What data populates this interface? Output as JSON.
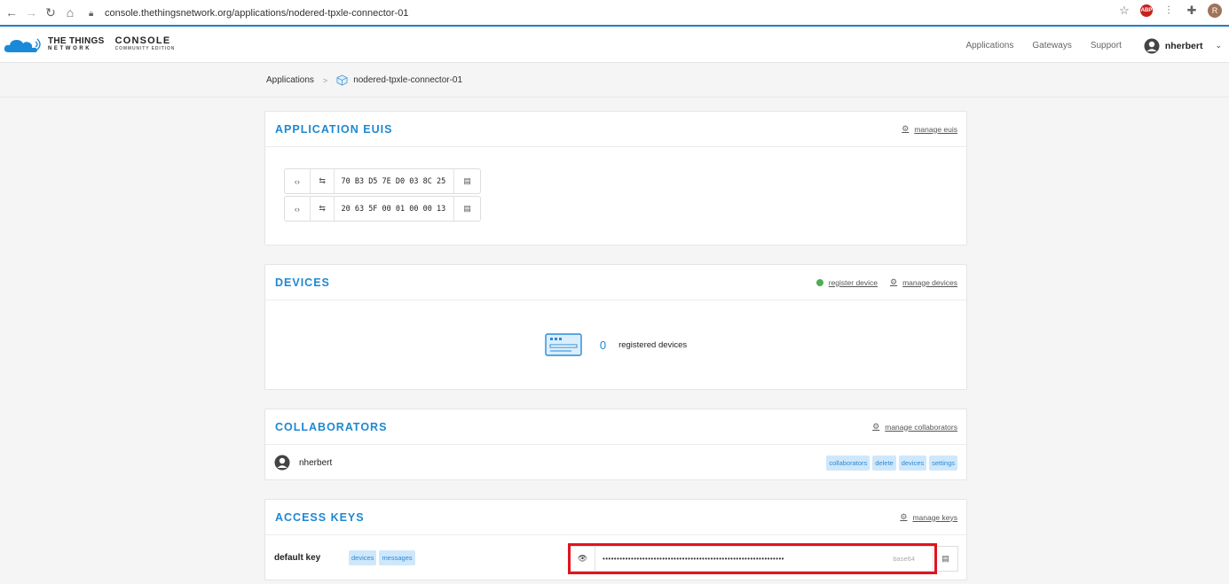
{
  "browser": {
    "url": "console.thethingsnetwork.org/applications/nodered-tpxle-connector-01",
    "profile_initial": "R",
    "adblock_label": "ABP"
  },
  "header": {
    "logo_line1": "THE THINGS",
    "logo_line2": "NETWORK",
    "console_line1": "CONSOLE",
    "console_line2": "COMMUNITY EDITION",
    "nav": [
      "Applications",
      "Gateways",
      "Support"
    ],
    "username": "nherbert"
  },
  "breadcrumb": {
    "root": "Applications",
    "current": "nodered-tpxle-connector-01"
  },
  "euis": {
    "title": "APPLICATION EUIS",
    "action": "manage euis",
    "items": [
      "70 B3 D5 7E D0 03 8C 25",
      "20 63 5F 00 01 00 00 13"
    ]
  },
  "devices": {
    "title": "DEVICES",
    "register_action": "register device",
    "manage_action": "manage devices",
    "count": "0",
    "count_label": "registered devices"
  },
  "collaborators": {
    "title": "COLLABORATORS",
    "action": "manage collaborators",
    "items": [
      {
        "name": "nherbert",
        "rights": [
          "collaborators",
          "delete",
          "devices",
          "settings"
        ]
      }
    ]
  },
  "access_keys": {
    "title": "ACCESS KEYS",
    "action": "manage keys",
    "items": [
      {
        "name": "default key",
        "rights": [
          "devices",
          "messages"
        ],
        "masked_value": "••••••••••••••••••••••••••••••••••••••••••••••••••••••••••••••••",
        "format": "base64"
      }
    ]
  },
  "colors": {
    "accent": "#1e88d0",
    "tag_bg": "#cfe7fb",
    "highlight": "#e0141e"
  }
}
